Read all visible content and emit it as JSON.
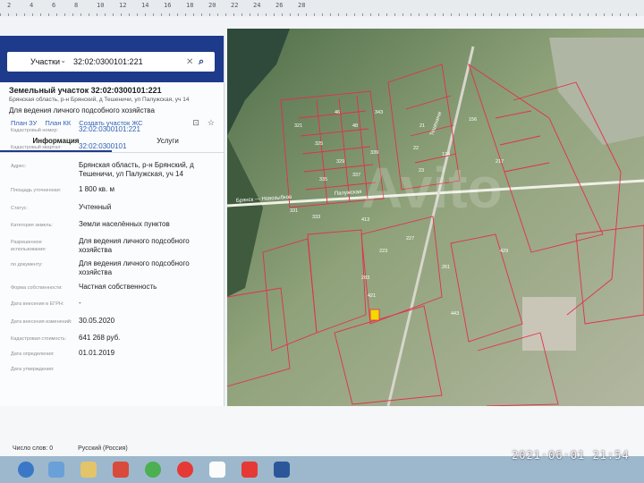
{
  "ruler": {
    "ticks": [
      "2",
      "4",
      "6",
      "8",
      "10",
      "12",
      "14",
      "16",
      "18",
      "20",
      "22",
      "24",
      "26",
      "28"
    ]
  },
  "search": {
    "mode_label": "Участки",
    "query": "32:02:0300101:221"
  },
  "parcel": {
    "title": "Земельный участок 32:02:0300101:221",
    "address_short": "Брянская область, р-н Брянский, д Тешеничи, ул Палужская, уч 14",
    "purpose": "Для ведения личного подсобного хозяйства",
    "links": [
      "План ЗУ",
      "План КК",
      "Создать участок ЖС"
    ]
  },
  "tabs": [
    {
      "label": "Информация",
      "active": true
    },
    {
      "label": "Услуги",
      "active": false
    }
  ],
  "fields": [
    {
      "key": "Кадастровый номер:",
      "value": "32:02:0300101:221",
      "link": true
    },
    {
      "key": "Кадастровый квартал:",
      "value": "32:02:0300101",
      "link": true
    },
    {
      "key": "Адрес:",
      "value": "Брянская область, р-н Брянский, д Тешеничи, ул Палужская, уч 14",
      "link": false
    },
    {
      "key": "Площадь уточненная:",
      "value": "1 800 кв. м",
      "link": false
    },
    {
      "key": "Статус:",
      "value": "Учтенный",
      "link": false
    },
    {
      "key": "Категория земель:",
      "value": "Земли населённых пунктов",
      "link": false
    },
    {
      "key": "Разрешенное использование:",
      "value": "Для ведения личного подсобного хозяйства",
      "link": false
    },
    {
      "key": "по документу:",
      "value": "Для ведения личного подсобного хозяйства",
      "link": false
    },
    {
      "key": "Форма собственности:",
      "value": "Частная собственность",
      "link": false
    },
    {
      "key": "Дата внесения в ЕГРН:",
      "value": "-",
      "link": false
    },
    {
      "key": "Дата внесения изменений:",
      "value": "30.05.2020",
      "link": false
    },
    {
      "key": "Кадастровая стоимость:",
      "value": "641 268 руб.",
      "link": false
    },
    {
      "key": "Дата определения:",
      "value": "01.01.2019",
      "link": false
    },
    {
      "key": "Дата утверждения:",
      "value": "",
      "link": false
    }
  ],
  "map": {
    "street_labels": [
      "Брянск — Новозыбков",
      "Тешеничи",
      "Палужская"
    ],
    "parcel_numbers": [
      "46",
      "48",
      "21",
      "22",
      "23",
      "124",
      "156",
      "217",
      "223",
      "227",
      "261",
      "283",
      "321",
      "325",
      "329",
      "331",
      "333",
      "335",
      "337",
      "339",
      "343",
      "413",
      "421",
      "429",
      "443"
    ]
  },
  "statusbar": {
    "words": "Число слов: 0",
    "lang": "Русский (Россия)"
  },
  "timestamp": "2021·06·01  21:54",
  "colors": {
    "header_blue": "#1e3a8a",
    "link_blue": "#2f5fb3",
    "parcel_red": "#e2304a",
    "selected_parcel": "#f5d800"
  }
}
